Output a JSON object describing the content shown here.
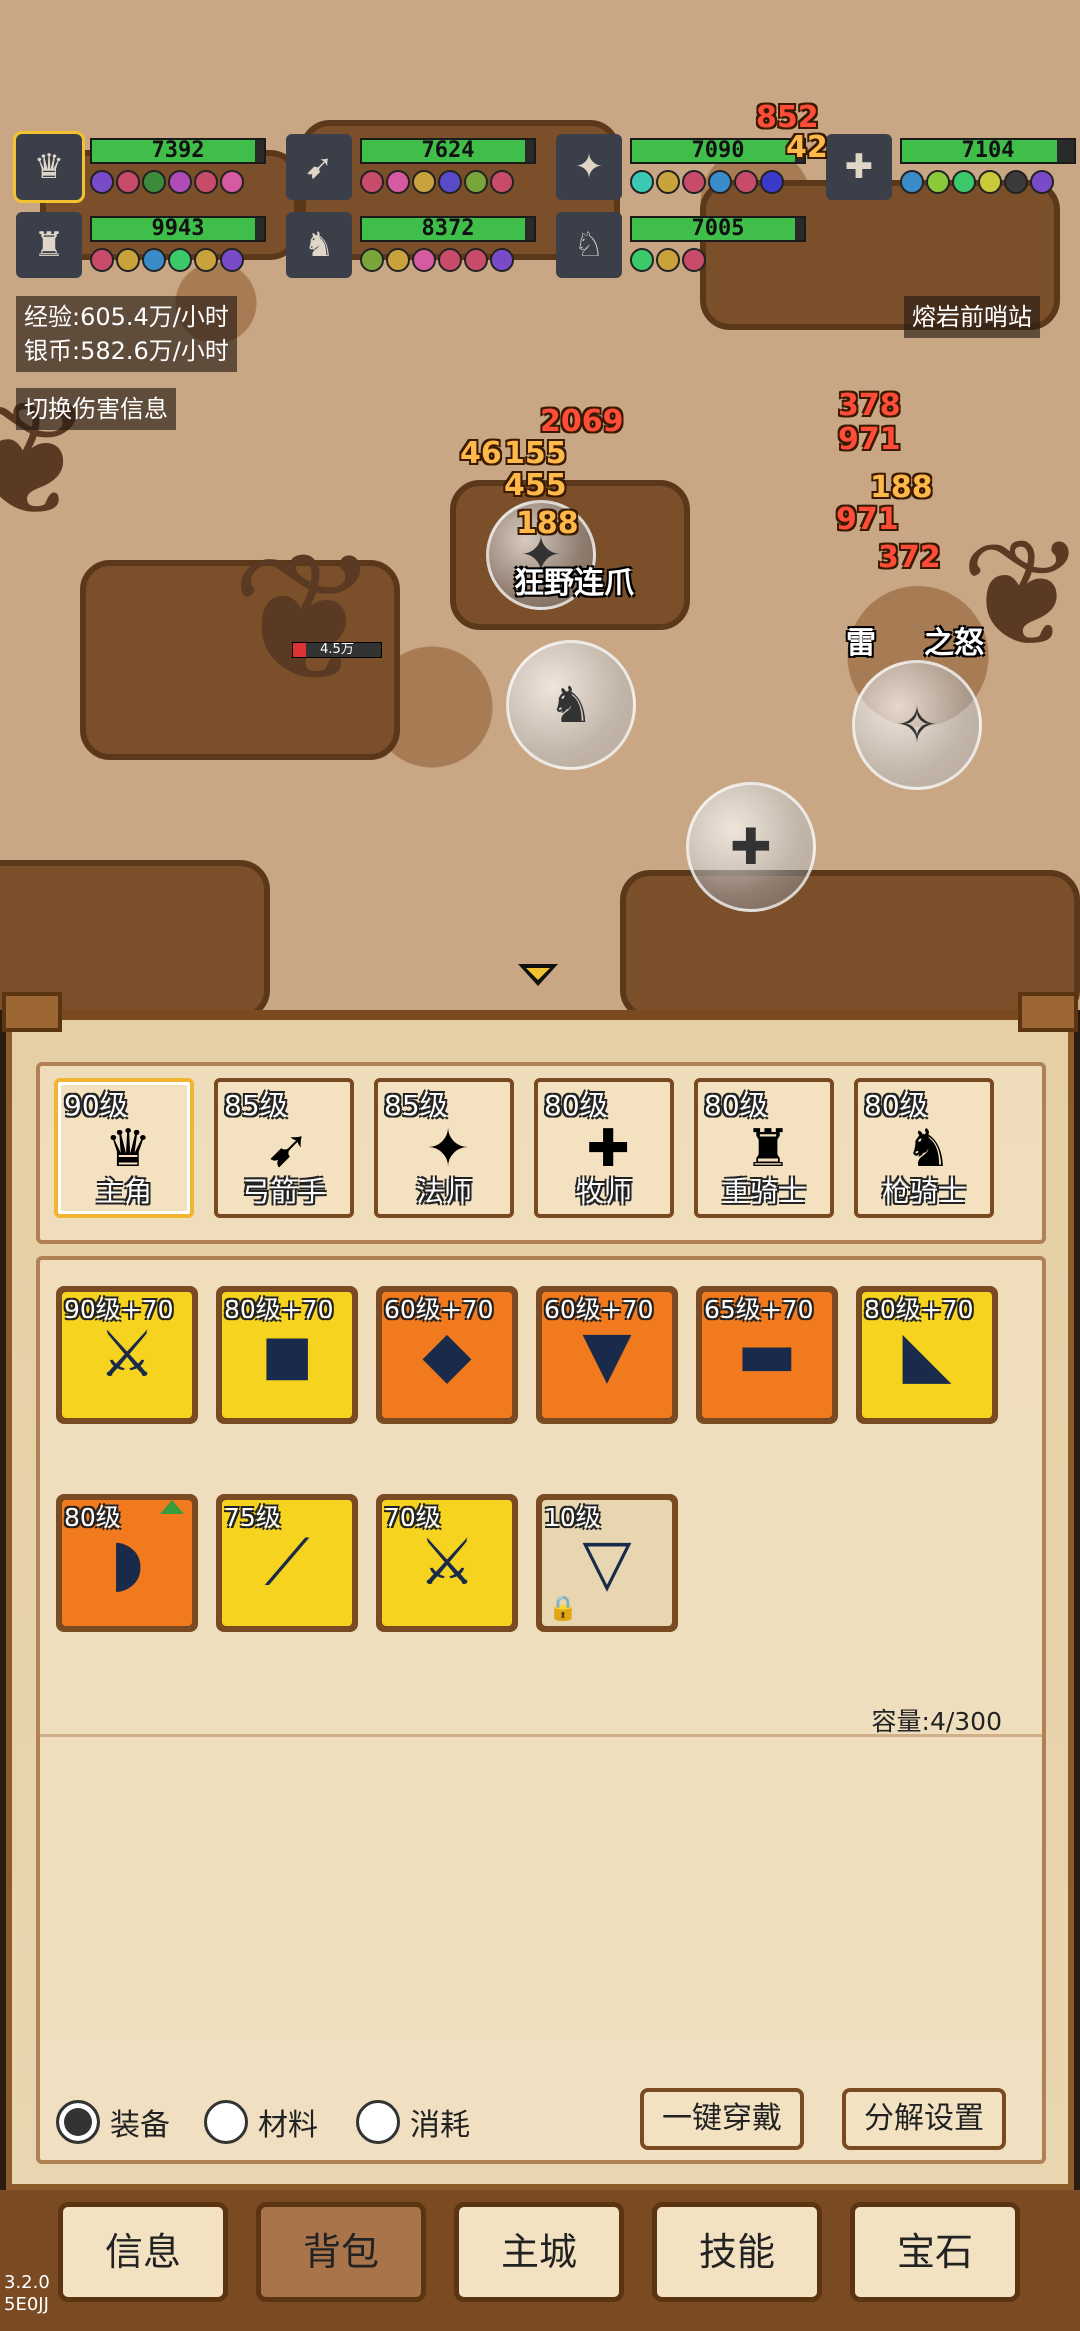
{
  "party": [
    {
      "hp": "7392",
      "hp_fill": 0.95,
      "icon": "swordsman-portrait",
      "buffs": [
        "#7a4bc9",
        "#c94b6a",
        "#3b8b3b",
        "#b04bb8",
        "#c94b6a",
        "#d65aa0"
      ]
    },
    {
      "hp": "7624",
      "hp_fill": 0.95,
      "icon": "archer-portrait",
      "buffs": [
        "#c94b6a",
        "#d65aa0",
        "#c9a23b",
        "#5a4bc9",
        "#7aa53b",
        "#c94b6a"
      ]
    },
    {
      "hp": "7090",
      "hp_fill": 0.95,
      "icon": "mage-portrait",
      "buffs": [
        "#3bc9b4",
        "#c9a23b",
        "#c94b6a",
        "#3b8bc9",
        "#c94b6a",
        "#3b3bc9"
      ]
    },
    {
      "hp": "7104",
      "hp_fill": 0.9,
      "icon": "priest-portrait",
      "buffs": [
        "#3b8bc9",
        "#8bc93b",
        "#3bc96a",
        "#c9c93b",
        "#3b3b3b",
        "#7a4bc9"
      ]
    },
    {
      "hp": "9943",
      "hp_fill": 0.95,
      "icon": "heavy-knight-portrait",
      "buffs": [
        "#c94b6a",
        "#c9a23b",
        "#3b8bc9",
        "#3bc96a",
        "#c9a23b",
        "#7a4bc9"
      ]
    },
    {
      "hp": "8372",
      "hp_fill": 0.95,
      "icon": "lancer-portrait",
      "buffs": [
        "#7aa53b",
        "#c9a23b",
        "#d65aa0",
        "#c94b6a",
        "#c94b6a",
        "#7a4bc9"
      ]
    },
    {
      "hp": "7005",
      "hp_fill": 0.95,
      "icon": "beast-portrait",
      "buffs": [
        "#3bc96a",
        "#c9a23b",
        "#c94b6a"
      ]
    }
  ],
  "info": {
    "exp": "经验:605.4万/小时",
    "silver": "银币:582.6万/小时",
    "toggle_damage": "切换伤害信息",
    "location": "熔岩前哨站"
  },
  "battle": {
    "skill1": "狂野连爪",
    "skill2": "雷",
    "skill2b": "之怒",
    "enemy_hp": "4.5万",
    "enemy_hp_fill": 0.15,
    "damage_numbers": [
      {
        "v": "852",
        "red": true
      },
      {
        "v": "42",
        "red": false
      },
      {
        "v": "2069",
        "red": true
      },
      {
        "v": "46",
        "red": false
      },
      {
        "v": "155",
        "red": false
      },
      {
        "v": "455",
        "red": false
      },
      {
        "v": "188",
        "red": false
      },
      {
        "v": "378",
        "red": true
      },
      {
        "v": "971",
        "red": true
      },
      {
        "v": "188",
        "red": false
      },
      {
        "v": "971",
        "red": true
      },
      {
        "v": "372",
        "red": true
      }
    ]
  },
  "characters": [
    {
      "level": "90级",
      "name": "主角",
      "icon": "swordsman-icon",
      "active": true
    },
    {
      "level": "85级",
      "name": "弓箭手",
      "icon": "archer-icon",
      "active": false
    },
    {
      "level": "85级",
      "name": "法师",
      "icon": "mage-icon",
      "active": false
    },
    {
      "level": "80级",
      "name": "牧师",
      "icon": "priest-icon",
      "active": false
    },
    {
      "level": "80级",
      "name": "重骑士",
      "icon": "heavy-knight-icon",
      "active": false
    },
    {
      "level": "80级",
      "name": "枪骑士",
      "icon": "lancer-icon",
      "active": false
    }
  ],
  "equipped": [
    {
      "level": "90级+70",
      "icon": "sword-icon",
      "bg": "#f5d31e"
    },
    {
      "level": "80级+70",
      "icon": "armor-icon",
      "bg": "#f5d31e"
    },
    {
      "level": "60级+70",
      "icon": "shirt-icon",
      "bg": "#f27a1e"
    },
    {
      "level": "60级+70",
      "icon": "pants-icon",
      "bg": "#f27a1e"
    },
    {
      "level": "65级+70",
      "icon": "bracer-icon",
      "bg": "#f27a1e"
    },
    {
      "level": "80级+70",
      "icon": "boots-icon",
      "bg": "#f5d31e"
    }
  ],
  "capacity": "容量:4/300",
  "inventory": [
    {
      "level": "80级",
      "icon": "shoulder-armor-icon",
      "bg": "#f27a1e",
      "upgrade": true,
      "locked": false
    },
    {
      "level": "75级",
      "icon": "blade-icon",
      "bg": "#f5d31e",
      "upgrade": false,
      "locked": false
    },
    {
      "level": "70级",
      "icon": "sword-icon",
      "bg": "#f5d31e",
      "upgrade": false,
      "locked": false
    },
    {
      "level": "10级",
      "icon": "leather-pants-icon",
      "bg": "#e8d6b0",
      "upgrade": false,
      "locked": true
    }
  ],
  "filters": {
    "equipment": "装备",
    "materials": "材料",
    "consumables": "消耗",
    "selected": "equipment"
  },
  "actions": {
    "equip_all": "一键穿戴",
    "dismantle_settings": "分解设置"
  },
  "nav": [
    {
      "label": "信息",
      "active": false
    },
    {
      "label": "背包",
      "active": true
    },
    {
      "label": "主城",
      "active": false
    },
    {
      "label": "技能",
      "active": false
    },
    {
      "label": "宝石",
      "active": false
    }
  ],
  "version": {
    "number": "3.2.0",
    "code": "5E0JJ"
  }
}
